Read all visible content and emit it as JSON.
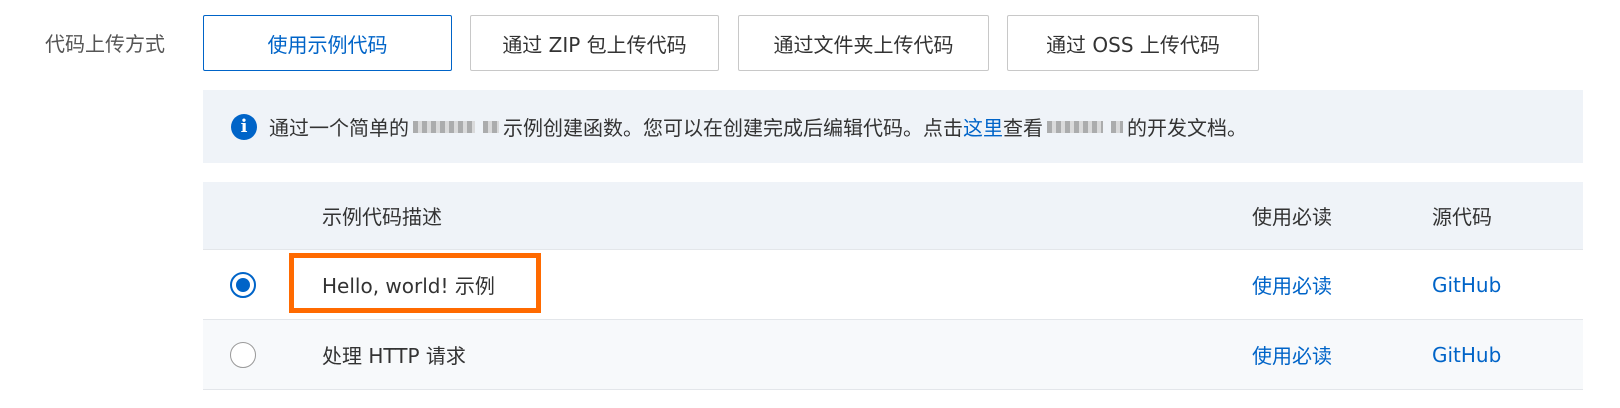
{
  "upload": {
    "label": "代码上传方式",
    "options": [
      {
        "label": "使用示例代码",
        "active": true
      },
      {
        "label": "通过 ZIP 包上传代码",
        "active": false
      },
      {
        "label": "通过文件夹上传代码",
        "active": false
      },
      {
        "label": "通过 OSS 上传代码",
        "active": false
      }
    ]
  },
  "notice": {
    "icon": "info-icon",
    "text_1": "通过一个简单的",
    "text_2": "示例创建函数。您可以在创建完成后编辑代码。点击",
    "link": "这里",
    "text_3": "查看",
    "text_4": "的开发文档。"
  },
  "table": {
    "headers": {
      "desc": "示例代码描述",
      "doc": "使用必读",
      "src": "源代码"
    },
    "rows": [
      {
        "desc": "Hello, world! 示例",
        "doc": "使用必读",
        "src": "GitHub",
        "selected": true
      },
      {
        "desc": "处理 HTTP 请求",
        "doc": "使用必读",
        "src": "GitHub",
        "selected": false
      }
    ]
  },
  "colors": {
    "accent": "#0064c8",
    "highlight": "#ff6a00"
  }
}
